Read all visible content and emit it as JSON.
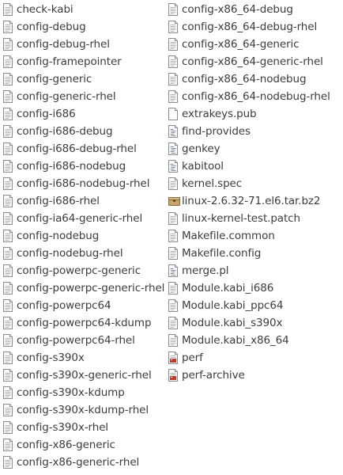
{
  "file_list": {
    "columns": [
      {
        "items": [
          {
            "name": "check-kabi",
            "icon": "text-file-icon"
          },
          {
            "name": "config-debug",
            "icon": "text-file-icon"
          },
          {
            "name": "config-debug-rhel",
            "icon": "text-file-icon"
          },
          {
            "name": "config-framepointer",
            "icon": "text-file-icon"
          },
          {
            "name": "config-generic",
            "icon": "text-file-icon"
          },
          {
            "name": "config-generic-rhel",
            "icon": "text-file-icon"
          },
          {
            "name": "config-i686",
            "icon": "text-file-icon"
          },
          {
            "name": "config-i686-debug",
            "icon": "text-file-icon"
          },
          {
            "name": "config-i686-debug-rhel",
            "icon": "text-file-icon"
          },
          {
            "name": "config-i686-nodebug",
            "icon": "text-file-icon"
          },
          {
            "name": "config-i686-nodebug-rhel",
            "icon": "text-file-icon"
          },
          {
            "name": "config-i686-rhel",
            "icon": "text-file-icon"
          },
          {
            "name": "config-ia64-generic-rhel",
            "icon": "text-file-icon"
          },
          {
            "name": "config-nodebug",
            "icon": "text-file-icon"
          },
          {
            "name": "config-nodebug-rhel",
            "icon": "text-file-icon"
          },
          {
            "name": "config-powerpc-generic",
            "icon": "text-file-icon"
          },
          {
            "name": "config-powerpc-generic-rhel",
            "icon": "text-file-icon"
          },
          {
            "name": "config-powerpc64",
            "icon": "text-file-icon"
          },
          {
            "name": "config-powerpc64-kdump",
            "icon": "text-file-icon"
          },
          {
            "name": "config-powerpc64-rhel",
            "icon": "text-file-icon"
          },
          {
            "name": "config-s390x",
            "icon": "text-file-icon"
          },
          {
            "name": "config-s390x-generic-rhel",
            "icon": "text-file-icon"
          },
          {
            "name": "config-s390x-kdump",
            "icon": "text-file-icon"
          },
          {
            "name": "config-s390x-kdump-rhel",
            "icon": "text-file-icon"
          },
          {
            "name": "config-s390x-rhel",
            "icon": "text-file-icon"
          },
          {
            "name": "config-x86-generic",
            "icon": "text-file-icon"
          },
          {
            "name": "config-x86-generic-rhel",
            "icon": "text-file-icon"
          }
        ]
      },
      {
        "items": [
          {
            "name": "config-x86_64-debug",
            "icon": "text-file-icon"
          },
          {
            "name": "config-x86_64-debug-rhel",
            "icon": "text-file-icon"
          },
          {
            "name": "config-x86_64-generic",
            "icon": "text-file-icon"
          },
          {
            "name": "config-x86_64-generic-rhel",
            "icon": "text-file-icon"
          },
          {
            "name": "config-x86_64-nodebug",
            "icon": "text-file-icon"
          },
          {
            "name": "config-x86_64-nodebug-rhel",
            "icon": "text-file-icon"
          },
          {
            "name": "extrakeys.pub",
            "icon": "blank-file-icon"
          },
          {
            "name": "find-provides",
            "icon": "script-file-icon"
          },
          {
            "name": "genkey",
            "icon": "script-file-icon"
          },
          {
            "name": "kabitool",
            "icon": "script-file-icon"
          },
          {
            "name": "kernel.spec",
            "icon": "text-file-icon"
          },
          {
            "name": "linux-2.6.32-71.el6.tar.bz2",
            "icon": "archive-icon"
          },
          {
            "name": "linux-kernel-test.patch",
            "icon": "text-file-icon"
          },
          {
            "name": "Makefile.common",
            "icon": "text-file-icon"
          },
          {
            "name": "Makefile.config",
            "icon": "text-file-icon"
          },
          {
            "name": "merge.pl",
            "icon": "script-file-icon"
          },
          {
            "name": "Module.kabi_i686",
            "icon": "text-file-icon"
          },
          {
            "name": "Module.kabi_ppc64",
            "icon": "text-file-icon"
          },
          {
            "name": "Module.kabi_s390x",
            "icon": "text-file-icon"
          },
          {
            "name": "Module.kabi_x86_64",
            "icon": "text-file-icon"
          },
          {
            "name": "perf",
            "icon": "executable-icon"
          },
          {
            "name": "perf-archive",
            "icon": "executable-icon"
          }
        ]
      }
    ]
  }
}
